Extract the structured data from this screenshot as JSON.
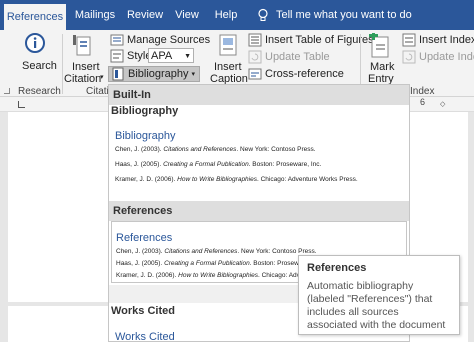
{
  "tabs": [
    {
      "label": "References",
      "active": true
    },
    {
      "label": "Mailings"
    },
    {
      "label": "Review"
    },
    {
      "label": "View"
    },
    {
      "label": "Help"
    }
  ],
  "tell_me": "Tell me what you want to do",
  "ribbon": {
    "search_label": "Search",
    "research_group": "Research",
    "insert_citation_line1": "Insert",
    "insert_citation_line2": "Citation",
    "manage_sources": "Manage Sources",
    "style_label": "Style:",
    "style_value": "APA",
    "bibliography_label": "Bibliography",
    "citations_group": "Citati",
    "insert_caption_line1": "Insert",
    "insert_caption_line2": "Caption",
    "insert_table_of_figures": "Insert Table of Figures",
    "update_table": "Update Table",
    "cross_reference": "Cross-reference",
    "mark_entry_line1": "Mark",
    "mark_entry_line2": "Entry",
    "insert_index": "Insert Index",
    "update_index": "Update Index",
    "index_group": "Index"
  },
  "ruler": {
    "mark_6": "6"
  },
  "dropdown": {
    "header": "Built-In",
    "sections": [
      {
        "header": "Bibliography",
        "title": "Bibliography",
        "entries": [
          {
            "author": "Chen, J. (2003). ",
            "work": "Citations and References",
            "rest": ". New York: Contoso Press."
          },
          {
            "author": "Haas, J. (2005). ",
            "work": "Creating a Formal Publication",
            "rest": ". Boston: Proseware, Inc."
          },
          {
            "author": "Kramer, J. D. (2006). ",
            "work": "How to Write Bibliographies",
            "rest": ". Chicago: Adventure Works Press."
          }
        ]
      },
      {
        "header": "References",
        "title": "References",
        "entries": [
          {
            "author": "Chen, J. (2003). ",
            "work": "Citations and References",
            "rest": ". New York: Contoso Press."
          },
          {
            "author": "Haas, J. (2005). ",
            "work": "Creating a Formal Publication",
            "rest": ". Boston: Proseware, Inc."
          },
          {
            "author": "Kramer, J. D. (2006). ",
            "work": "How to Write Bibliographies",
            "rest": ". Chicago: Adventure Works Press."
          }
        ]
      },
      {
        "header": "Works Cited",
        "title": "Works Cited"
      }
    ]
  },
  "tooltip": {
    "title": "References",
    "body": "Automatic bibliography (labeled \"References\") that includes all sources associated with the document"
  },
  "colors": {
    "accent": "#2b579a",
    "hover": "#c6c6c6"
  }
}
